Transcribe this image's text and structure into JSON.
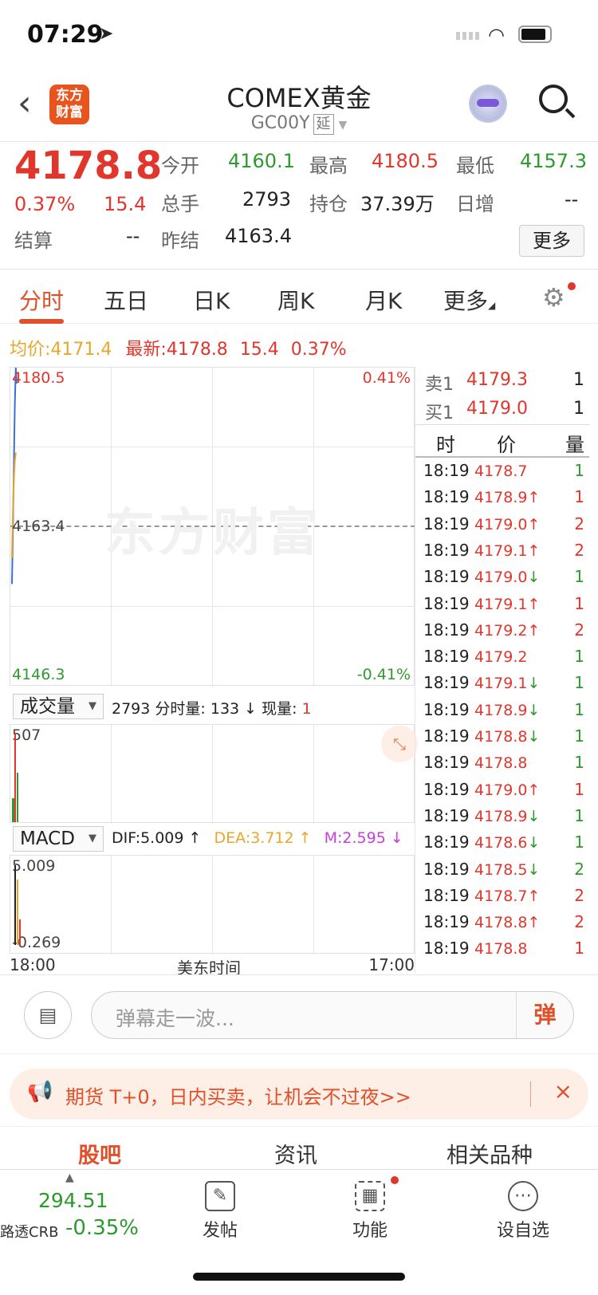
{
  "status_bar": {
    "time": "07:29"
  },
  "header": {
    "back_icon": "chevron-left-icon",
    "logo_line1": "东方",
    "logo_line2": "财富",
    "title": "COMEX黄金",
    "code": "GC00Y",
    "delay_badge": "延",
    "avatar_icon": "robot-avatar-icon",
    "search_icon": "search-icon"
  },
  "quote": {
    "price": "4178.8",
    "change_pct": "0.37%",
    "change": "15.4",
    "open_label": "今开",
    "open": "4160.1",
    "high_label": "最高",
    "high": "4180.5",
    "low_label": "最低",
    "low": "4157.3",
    "volume_label": "总手",
    "volume": "2793",
    "oi_label": "持仓",
    "oi": "37.39万",
    "daily_inc_label": "日增",
    "daily_inc": "--",
    "settle_label": "结算",
    "settle": "--",
    "prev_settle_label": "昨结",
    "prev_settle": "4163.4",
    "more_label": "更多"
  },
  "tabs": [
    "分时",
    "五日",
    "日K",
    "周K",
    "月K",
    "更多"
  ],
  "settings_icon": "gear-icon",
  "info_line": {
    "avg_label": "均价:",
    "avg": "4171.4",
    "latest_label": "最新:",
    "latest": "4178.8",
    "chg": "15.4",
    "pct": "0.37%"
  },
  "chart": {
    "y_top": "4180.5",
    "y_mid": "4163.4",
    "y_bot": "4146.3",
    "pct_top": "0.41%",
    "pct_bot": "-0.41%",
    "watermark": "东方财富",
    "volume_selector": "成交量",
    "vol_total": "2793",
    "vol_min_label": "分时量:",
    "vol_min": "133",
    "vol_cur_label": "现量:",
    "vol_cur": "1",
    "vol_max": "507",
    "macd_selector": "MACD",
    "dif": "DIF:5.009",
    "dea": "DEA:3.712",
    "m": "M:2.595",
    "macd_top": "5.009",
    "macd_bot": "-0.269",
    "x_start": "18:00",
    "x_mid": "美东时间",
    "x_end": "17:00"
  },
  "chart_data": {
    "type": "line",
    "title": "",
    "ylim": [
      4146.3,
      4180.5
    ],
    "reference_line": 4163.4,
    "series": [
      {
        "name": "",
        "values": [
          4157.3,
          4163.0,
          4170.2,
          4176.5,
          4180.5,
          4178.8
        ]
      },
      {
        "name": "均价",
        "values": [
          4160.1,
          4165.0,
          4168.5,
          4170.5,
          4171.4
        ]
      }
    ]
  },
  "order_book": {
    "sell_label": "卖1",
    "sell_price": "4179.3",
    "sell_qty": "1",
    "buy_label": "买1",
    "buy_price": "4179.0",
    "buy_qty": "1",
    "col_time": "时",
    "col_price": "价",
    "col_qty": "量"
  },
  "trades": [
    {
      "time": "18:19",
      "price": "4178.7",
      "dir": "",
      "qty": "1",
      "pc": "red",
      "qc": "green"
    },
    {
      "time": "18:19",
      "price": "4178.9",
      "dir": "↑",
      "qty": "1",
      "pc": "red",
      "qc": "red"
    },
    {
      "time": "18:19",
      "price": "4179.0",
      "dir": "↑",
      "qty": "2",
      "pc": "red",
      "qc": "red"
    },
    {
      "time": "18:19",
      "price": "4179.1",
      "dir": "↑",
      "qty": "2",
      "pc": "red",
      "qc": "red"
    },
    {
      "time": "18:19",
      "price": "4179.0",
      "dir": "↓",
      "qty": "1",
      "pc": "red",
      "qc": "green"
    },
    {
      "time": "18:19",
      "price": "4179.1",
      "dir": "↑",
      "qty": "1",
      "pc": "red",
      "qc": "red"
    },
    {
      "time": "18:19",
      "price": "4179.2",
      "dir": "↑",
      "qty": "2",
      "pc": "red",
      "qc": "red"
    },
    {
      "time": "18:19",
      "price": "4179.2",
      "dir": "",
      "qty": "1",
      "pc": "red",
      "qc": "green"
    },
    {
      "time": "18:19",
      "price": "4179.1",
      "dir": "↓",
      "qty": "1",
      "pc": "red",
      "qc": "green"
    },
    {
      "time": "18:19",
      "price": "4178.9",
      "dir": "↓",
      "qty": "1",
      "pc": "red",
      "qc": "green"
    },
    {
      "time": "18:19",
      "price": "4178.8",
      "dir": "↓",
      "qty": "1",
      "pc": "red",
      "qc": "green"
    },
    {
      "time": "18:19",
      "price": "4178.8",
      "dir": "",
      "qty": "1",
      "pc": "red",
      "qc": "green"
    },
    {
      "time": "18:19",
      "price": "4179.0",
      "dir": "↑",
      "qty": "1",
      "pc": "red",
      "qc": "red"
    },
    {
      "time": "18:19",
      "price": "4178.9",
      "dir": "↓",
      "qty": "1",
      "pc": "red",
      "qc": "green"
    },
    {
      "time": "18:19",
      "price": "4178.6",
      "dir": "↓",
      "qty": "1",
      "pc": "red",
      "qc": "green"
    },
    {
      "time": "18:19",
      "price": "4178.5",
      "dir": "↓",
      "qty": "2",
      "pc": "red",
      "qc": "green"
    },
    {
      "time": "18:19",
      "price": "4178.7",
      "dir": "↑",
      "qty": "2",
      "pc": "red",
      "qc": "red"
    },
    {
      "time": "18:19",
      "price": "4178.8",
      "dir": "↑",
      "qty": "2",
      "pc": "red",
      "qc": "red"
    },
    {
      "time": "18:19",
      "price": "4178.8",
      "dir": "",
      "qty": "1",
      "pc": "red",
      "qc": "red"
    }
  ],
  "comment": {
    "placeholder": "弹幕走一波...",
    "danmu_btn": "弹"
  },
  "promo": {
    "text": "期货 T+0，日内买卖，让机会不过夜>>",
    "close": "×"
  },
  "subtabs": [
    "股吧",
    "资讯",
    "相关品种"
  ],
  "bottom_bar": {
    "index_value": "294.51",
    "index_name": "路透CRB",
    "index_change": "-0.35%",
    "post_label": "发帖",
    "func_label": "功能",
    "watch_label": "设自选"
  },
  "colors": {
    "up": "#e0362c",
    "down": "#2e9a2e",
    "accent": "#e0502a",
    "avg": "#e6a72a"
  }
}
